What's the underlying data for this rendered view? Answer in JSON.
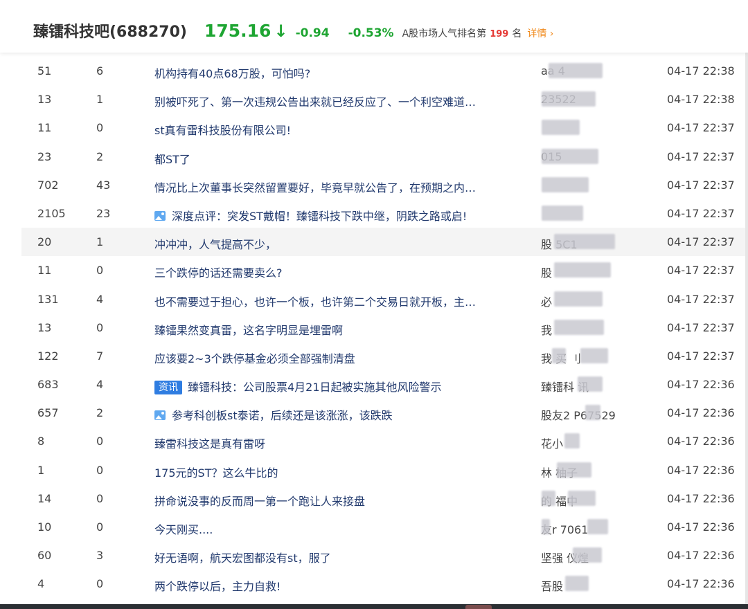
{
  "header": {
    "title": "臻镭科技吧(688270)",
    "price": "175.16",
    "direction_icon": "down-arrow-icon",
    "direction_glyph": "↓",
    "change": "-0.94",
    "change_pct": "-0.53%",
    "rank_prefix": "A股市场人气排名第",
    "rank_value": "199",
    "rank_suffix": "名",
    "detail_label": "详情",
    "detail_icon": "chevron-right-icon",
    "detail_glyph": "›",
    "colors": {
      "down": "#1ea532",
      "rank": "#e53935",
      "link": "#f08a1c",
      "badge": "#2f7de1",
      "title": "#223a6e"
    }
  },
  "posts": [
    {
      "reads": "51",
      "replies": "6",
      "title": "机构持有40点68万股，可怕吗?",
      "icon": "",
      "badge": "",
      "author": "aa  4",
      "time": "04-17 22:38"
    },
    {
      "reads": "13",
      "replies": "1",
      "title": "别被吓死了、第一次违规公告出来就已经反应了、一个利空难道…",
      "icon": "",
      "badge": "",
      "author": "23522",
      "time": "04-17 22:38"
    },
    {
      "reads": "11",
      "replies": "0",
      "title": "st真有雷科技股份有限公司!",
      "icon": "",
      "badge": "",
      "author": "",
      "time": "04-17 22:37"
    },
    {
      "reads": "23",
      "replies": "2",
      "title": "都ST了",
      "icon": "",
      "badge": "",
      "author": "015",
      "time": "04-17 22:37"
    },
    {
      "reads": "702",
      "replies": "43",
      "title": "情况比上次董事长突然留置要好，毕竟早就公告了，在预期之内…",
      "icon": "",
      "badge": "",
      "author": "",
      "time": "04-17 22:37"
    },
    {
      "reads": "2105",
      "replies": "23",
      "title": "深度点评：突发ST戴帽！臻镭科技下跌中继，阴跌之路或启!",
      "icon": "image-icon",
      "badge": "",
      "author": "",
      "time": "04-17 22:37"
    },
    {
      "reads": "20",
      "replies": "1",
      "title": "冲冲冲，人气提高不少，",
      "icon": "",
      "badge": "",
      "author": "股  5C1",
      "time": "04-17 22:37"
    },
    {
      "reads": "11",
      "replies": "0",
      "title": "三个跌停的话还需要卖么?",
      "icon": "",
      "badge": "",
      "author": "股",
      "time": "04-17 22:37"
    },
    {
      "reads": "131",
      "replies": "4",
      "title": "也不需要过于担心，也许一个板，也许第二个交易日就开板，主…",
      "icon": "",
      "badge": "",
      "author": "必",
      "time": "04-17 22:37"
    },
    {
      "reads": "13",
      "replies": "0",
      "title": "臻镭果然变真雷，这名字明显是埋雷啊",
      "icon": "",
      "badge": "",
      "author": "我",
      "time": "04-17 22:37"
    },
    {
      "reads": "122",
      "replies": "7",
      "title": "应该要2~3个跌停基金必须全部强制清盘",
      "icon": "",
      "badge": "",
      "author": "我  买  刂",
      "time": "04-17 22:37"
    },
    {
      "reads": "683",
      "replies": "4",
      "title": "臻镭科技：公司股票4月21日起被实施其他风险警示",
      "icon": "",
      "badge": "资讯",
      "author": "臻镭科  讯",
      "time": "04-17 22:36"
    },
    {
      "reads": "657",
      "replies": "2",
      "title": "参考科创板st泰诺，后续还是该涨涨，该跌跌",
      "icon": "image-icon",
      "badge": "",
      "author": "股友2  P67529",
      "time": "04-17 22:36"
    },
    {
      "reads": "8",
      "replies": "0",
      "title": "臻雷科技这是真有雷呀",
      "icon": "",
      "badge": "",
      "author": "花小",
      "time": "04-17 22:36"
    },
    {
      "reads": "1",
      "replies": "0",
      "title": "175元的ST？这么牛比的",
      "icon": "",
      "badge": "",
      "author": "林  柚子",
      "time": "04-17 22:36"
    },
    {
      "reads": "14",
      "replies": "0",
      "title": "拼命说没事的反而周一第一个跑让人来接盘",
      "icon": "",
      "badge": "",
      "author": "  的  福中",
      "time": "04-17 22:36"
    },
    {
      "reads": "10",
      "replies": "0",
      "title": "今天刚买....",
      "icon": "",
      "badge": "",
      "author": "友r  7061",
      "time": "04-17 22:36"
    },
    {
      "reads": "60",
      "replies": "3",
      "title": "好无语啊，航天宏图都没有st，服了",
      "icon": "",
      "badge": "",
      "author": "坚强  仪煌",
      "time": "04-17 22:36"
    },
    {
      "reads": "4",
      "replies": "0",
      "title": "两个跌停以后，主力自救!",
      "icon": "",
      "badge": "",
      "author": "吾股",
      "time": "04-17 22:36"
    }
  ]
}
